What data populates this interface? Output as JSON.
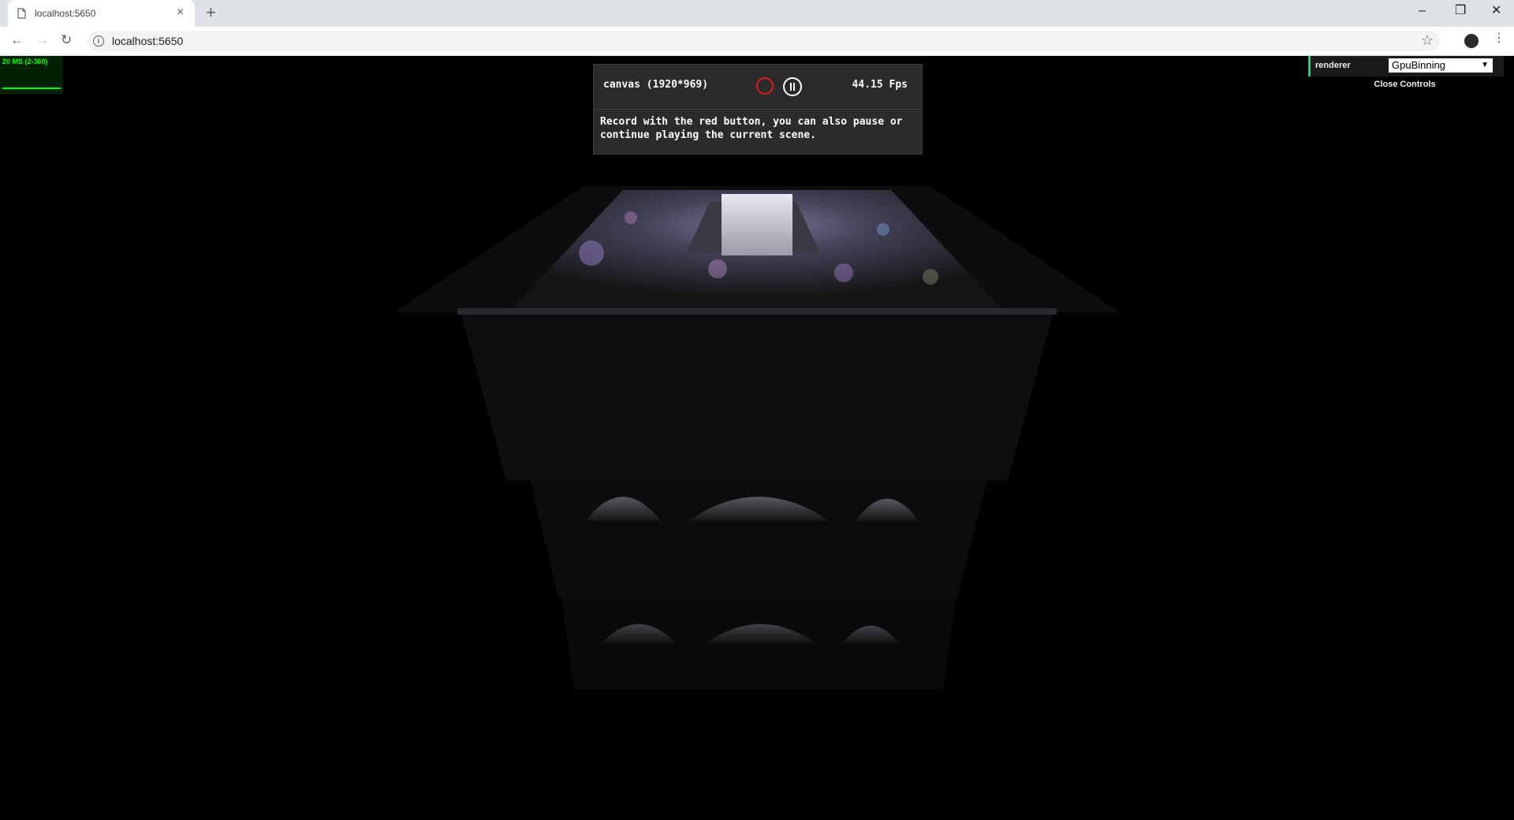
{
  "browser": {
    "tab_title": "localhost:5650",
    "tab_close": "×",
    "new_tab": "+",
    "url": "localhost:5650",
    "window_controls": {
      "minimize": "–",
      "restore": "❐",
      "close": "✕"
    }
  },
  "stats": {
    "text": "20 MS (2-360)"
  },
  "recorder": {
    "title": "canvas (1920*969)",
    "fps": "44.15 Fps",
    "description": "Record with the red button, you can also pause or continue playing the current scene.",
    "record_color": "#e01b1b"
  },
  "gui": {
    "renderer_label": "renderer",
    "renderer_value": "GpuBinning",
    "close_label": "Close Controls",
    "accent": "#1ed36f"
  }
}
